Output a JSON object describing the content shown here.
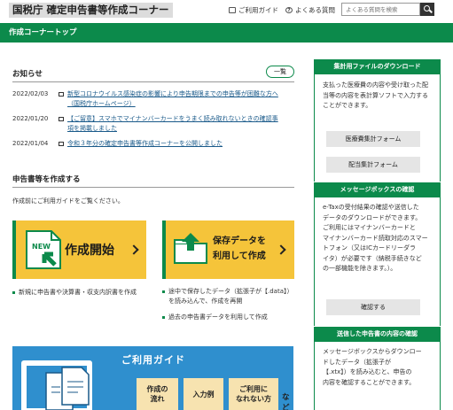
{
  "header": {
    "logo": "国税庁 確定申告書等作成コーナー",
    "guide_link": "ご利用ガイド",
    "faq_link": "よくある質問",
    "search_placeholder": "よくある質問を検索"
  },
  "navbar": {
    "title": "作成コーナートップ"
  },
  "news": {
    "title": "お知らせ",
    "more_button": "一覧",
    "items": [
      {
        "date": "2022/02/03",
        "text_line1": "新型コロナウイルス感染症の影響により申告期限までの申告等が困難な方へ",
        "text_line2": "（国税庁ホームページ）"
      },
      {
        "date": "2022/01/20",
        "text_line1": "【ご留意】スマホでマイナンバーカードをうまく読み取れないときの確認事",
        "text_line2": "項を掲載しました"
      },
      {
        "date": "2022/01/04",
        "text_line1": "令和３年分の確定申告書等作成コーナーを公開しました",
        "text_line2": ""
      }
    ]
  },
  "create": {
    "title": "申告書等を作成する",
    "intro": "作成前にご利用ガイドをご覧ください。",
    "start_card": {
      "label": "作成開始",
      "badge": "NEW",
      "bullets": [
        "新規に申告書や決算書・収支内訳書を作成"
      ]
    },
    "saved_card": {
      "label_line1": "保存データを",
      "label_line2": "利用して作成",
      "bullets": [
        "途中で保存したデータ（拡張子が【.data】）",
        "を読み込んで、作成を再開",
        "過去の申告書データを利用して作成"
      ]
    }
  },
  "guide": {
    "title": "ご利用ガイド",
    "boxes": [
      "作成の|流れ",
      "入力例",
      "ご利用に|なれない方"
    ],
    "suffix": "など"
  },
  "sidebar": {
    "download": {
      "title": "集計用ファイルのダウンロード",
      "text": "支払った医療費の内容や受け取った配当等の内容を表計算ソフトで入力することができます。",
      "buttons": [
        "医療費集計フォーム",
        "配当集計フォーム"
      ]
    },
    "messagebox": {
      "title": "メッセージボックスの確認",
      "text": "e-Taxの受付結果の確認や送信した申告書等の内容の確認やデータのダウンロードができます。ご利用にはマイナンバーカードとマイナンバーカード読取対応のスマートフォン（又はICカードリーダライタ）が必要です（納税手続きなどの一部機能を除きます。）。",
      "lines": [
        "e-Taxの受付結果の確認や送信した",
        "データのダウンロードができます。",
        "ご利用にはマイナンバーカードと",
        "マイナンバーカード読取対応のスマー",
        "トフォン（又はICカードリーダラ",
        "イタ）が必要です（納税手続きなど",
        "の一部機能を除きます。）。"
      ],
      "button": "確認する"
    },
    "sent": {
      "title": "送信した申告書の内容の確認",
      "lines": [
        "メッセージボックスからダウンロー",
        "ドしたデータ（拡張子が",
        "【.xtx】）を読み込むと、申告の",
        "内容を確認することができます。"
      ]
    }
  },
  "colors": {
    "brand_green": "#0c8a4b",
    "card_yellow": "#f5c43a",
    "guide_blue": "#2f8fce"
  }
}
